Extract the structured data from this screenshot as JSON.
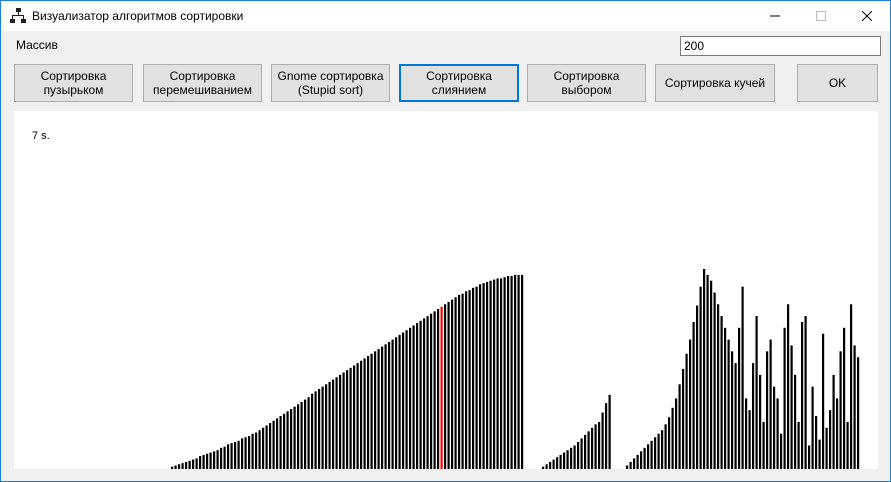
{
  "window": {
    "title": "Визуализатор алгоритмов сортировки",
    "icon": "flowchart-icon"
  },
  "array_label": "Массив",
  "array_size": "200",
  "buttons": [
    {
      "label": "Сортировка\nпузырьком"
    },
    {
      "label": "Сортировка\nперемешиванием"
    },
    {
      "label": "Gnome сортировка\n(Stupid sort)"
    },
    {
      "label": "Сортировка\nслиянием"
    },
    {
      "label": "Сортировка\nвыбором"
    },
    {
      "label": "Сортировка кучей"
    },
    {
      "label": "OK"
    }
  ],
  "elapsed": "7 s.",
  "chart_data": {
    "type": "bar",
    "bar_color": "#000000",
    "highlight_color": "#ff0000",
    "highlight_index": 121,
    "values": [
      0,
      0,
      0,
      0,
      0,
      0,
      0,
      0,
      0,
      0,
      0,
      0,
      0,
      0,
      0,
      0,
      0,
      0,
      0,
      0,
      0,
      0,
      0,
      0,
      0,
      0,
      0,
      0,
      0,
      0,
      0,
      0,
      0,
      0,
      0,
      0,
      0,
      0,
      0,
      0,
      0,
      0,
      0,
      0,
      2,
      3,
      4,
      5,
      6,
      7,
      8,
      9,
      11,
      12,
      13,
      14,
      15,
      16,
      18,
      19,
      21,
      22,
      23,
      24,
      26,
      27,
      28,
      30,
      31,
      33,
      35,
      37,
      39,
      41,
      43,
      45,
      47,
      49,
      51,
      53,
      55,
      57,
      59,
      61,
      64,
      66,
      68,
      70,
      72,
      74,
      76,
      78,
      80,
      82,
      84,
      86,
      88,
      90,
      92,
      94,
      96,
      98,
      100,
      102,
      104,
      106,
      108,
      110,
      112,
      114,
      116,
      118,
      120,
      122,
      124,
      126,
      128,
      130,
      132,
      134,
      136,
      138,
      140,
      142,
      144,
      146,
      148,
      149,
      151,
      152,
      154,
      155,
      157,
      158,
      159,
      160,
      161,
      162,
      162,
      163,
      164,
      164,
      165,
      165,
      165,
      0,
      0,
      0,
      0,
      0,
      2,
      4,
      6,
      8,
      10,
      12,
      14,
      16,
      18,
      20,
      23,
      26,
      29,
      32,
      35,
      38,
      40,
      48,
      56,
      63,
      0,
      0,
      0,
      0,
      3,
      6,
      9,
      12,
      15,
      18,
      21,
      24,
      27,
      30,
      33,
      38,
      44,
      52,
      60,
      72,
      85,
      98,
      110,
      125,
      139,
      155,
      170,
      165,
      160,
      150,
      140,
      130,
      120,
      110,
      100,
      90,
      120,
      155,
      60,
      50,
      90,
      130,
      80,
      40,
      100,
      110,
      70,
      60,
      30,
      120,
      140,
      105,
      80,
      40,
      125,
      130,
      20,
      70,
      45,
      25,
      115,
      35,
      50,
      80,
      60,
      100,
      120,
      40,
      140,
      105,
      95
    ],
    "ymax": 170
  }
}
